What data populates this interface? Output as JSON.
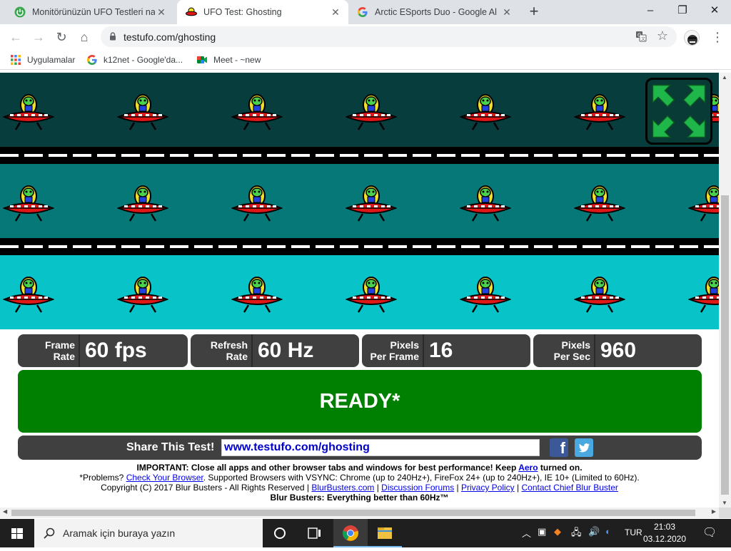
{
  "browser": {
    "tabs": [
      {
        "title": "Monitörünüzün UFO Testleri nası",
        "active": false,
        "favicon": "power-icon"
      },
      {
        "title": "UFO Test: Ghosting",
        "active": true,
        "favicon": "ufo-icon"
      },
      {
        "title": "Arctic ESports Duo - Google Alış",
        "active": false,
        "favicon": "google-icon"
      }
    ],
    "new_tab": "+",
    "window": {
      "minimize": "–",
      "restore": "❐",
      "close": "✕"
    },
    "url": "testufo.com/ghosting",
    "bookmarks": [
      {
        "label": "Uygulamalar",
        "icon": "apps-grid-icon"
      },
      {
        "label": "k12net - Google'da...",
        "icon": "google-icon"
      },
      {
        "label": "Meet - ~new",
        "icon": "meet-icon"
      }
    ]
  },
  "test": {
    "stats": [
      {
        "label_line1": "Frame",
        "label_line2": "Rate",
        "value": "60 fps"
      },
      {
        "label_line1": "Refresh",
        "label_line2": "Rate",
        "value": "60 Hz"
      },
      {
        "label_line1": "Pixels",
        "label_line2": "Per Frame",
        "value": "16"
      },
      {
        "label_line1": "Pixels",
        "label_line2": "Per Sec",
        "value": "960"
      }
    ],
    "status": "READY*",
    "share_label": "Share This Test!",
    "share_url": "www.testufo.com/ghosting",
    "facebook": "f",
    "lane_colors": [
      "#073d3d",
      "#077878",
      "#08c4c9"
    ],
    "ready_color": "#008000"
  },
  "footer": {
    "important_bold": "IMPORTANT: Close all apps and other browser tabs and windows for best performance! Keep",
    "aero": "Aero",
    "turned_on": "turned on.",
    "problems": "*Problems?",
    "check_browser": "Check Your Browser",
    "supported": ". Supported Browsers with VSYNC: Chrome (up to 240Hz+), FireFox 24+ (up to 240Hz+), IE 10+ (Limited to 60Hz).",
    "copyright": "Copyright (C) 2017 Blur Busters - All Rights Reserved |",
    "links": [
      "BlurBusters.com",
      "Discussion Forums",
      "Privacy Policy",
      "Contact Chief Blur Buster"
    ],
    "tagline": "Blur Busters: Everything better than 60Hz™"
  },
  "taskbar": {
    "search_placeholder": "Aramak için buraya yazın",
    "language": "TUR",
    "time": "21:03",
    "date": "03.12.2020"
  }
}
